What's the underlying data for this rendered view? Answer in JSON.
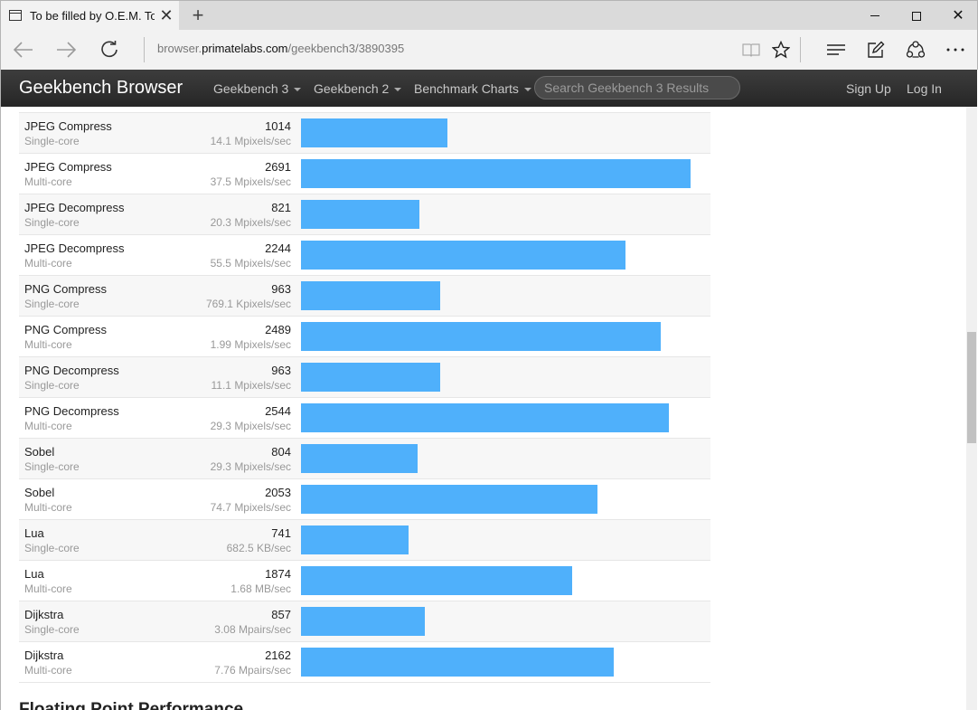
{
  "browser": {
    "tab_title": "To be filled by O.E.M. To",
    "tab_close_glyph": "✕",
    "new_tab_glyph": "+",
    "url_prefix": "browser.",
    "url_domain": "primatelabs.com",
    "url_path": "/geekbench3/3890395"
  },
  "header": {
    "brand": "Geekbench Browser",
    "nav": [
      "Geekbench 3",
      "Geekbench 2",
      "Benchmark Charts"
    ],
    "search_placeholder": "Search Geekbench 3 Results",
    "sign_up": "Sign Up",
    "log_in": "Log In"
  },
  "results": {
    "max_score": 2800,
    "bar_color": "#4fb0fb",
    "rows": [
      {
        "name": "JPEG Compress",
        "mode": "Single-core",
        "score": "1014",
        "rate": "14.1 Mpixels/sec",
        "value": 1014
      },
      {
        "name": "JPEG Compress",
        "mode": "Multi-core",
        "score": "2691",
        "rate": "37.5 Mpixels/sec",
        "value": 2691
      },
      {
        "name": "JPEG Decompress",
        "mode": "Single-core",
        "score": "821",
        "rate": "20.3 Mpixels/sec",
        "value": 821
      },
      {
        "name": "JPEG Decompress",
        "mode": "Multi-core",
        "score": "2244",
        "rate": "55.5 Mpixels/sec",
        "value": 2244
      },
      {
        "name": "PNG Compress",
        "mode": "Single-core",
        "score": "963",
        "rate": "769.1 Kpixels/sec",
        "value": 963
      },
      {
        "name": "PNG Compress",
        "mode": "Multi-core",
        "score": "2489",
        "rate": "1.99 Mpixels/sec",
        "value": 2489
      },
      {
        "name": "PNG Decompress",
        "mode": "Single-core",
        "score": "963",
        "rate": "11.1 Mpixels/sec",
        "value": 963
      },
      {
        "name": "PNG Decompress",
        "mode": "Multi-core",
        "score": "2544",
        "rate": "29.3 Mpixels/sec",
        "value": 2544
      },
      {
        "name": "Sobel",
        "mode": "Single-core",
        "score": "804",
        "rate": "29.3 Mpixels/sec",
        "value": 804
      },
      {
        "name": "Sobel",
        "mode": "Multi-core",
        "score": "2053",
        "rate": "74.7 Mpixels/sec",
        "value": 2053
      },
      {
        "name": "Lua",
        "mode": "Single-core",
        "score": "741",
        "rate": "682.5 KB/sec",
        "value": 741
      },
      {
        "name": "Lua",
        "mode": "Multi-core",
        "score": "1874",
        "rate": "1.68 MB/sec",
        "value": 1874
      },
      {
        "name": "Dijkstra",
        "mode": "Single-core",
        "score": "857",
        "rate": "3.08 Mpairs/sec",
        "value": 857
      },
      {
        "name": "Dijkstra",
        "mode": "Multi-core",
        "score": "2162",
        "rate": "7.76 Mpairs/sec",
        "value": 2162
      }
    ]
  },
  "next_section": "Floating Point Performance",
  "icons": {
    "tab": "tab-page-icon",
    "back": "back-arrow-icon",
    "forward": "forward-arrow-icon",
    "refresh": "refresh-icon",
    "reading_view": "reading-view-icon",
    "favorite": "star-icon",
    "hub": "hub-icon",
    "web_note": "web-note-icon",
    "share": "share-icon",
    "more": "more-icon"
  }
}
